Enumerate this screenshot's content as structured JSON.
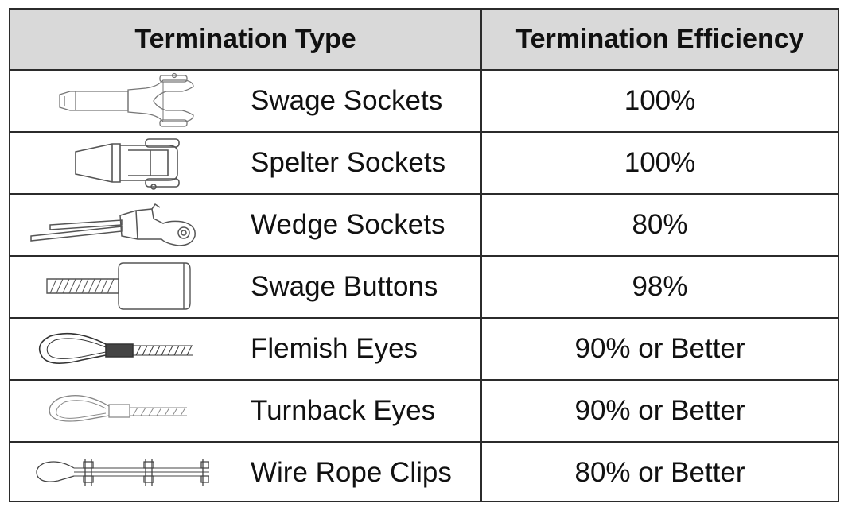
{
  "header": {
    "col1": "Termination Type",
    "col2": "Termination Efficiency"
  },
  "rows": [
    {
      "type": "Swage Sockets",
      "efficiency": "100%",
      "icon": "swage-socket-icon"
    },
    {
      "type": "Spelter Sockets",
      "efficiency": "100%",
      "icon": "spelter-socket-icon"
    },
    {
      "type": "Wedge Sockets",
      "efficiency": "80%",
      "icon": "wedge-socket-icon"
    },
    {
      "type": "Swage Buttons",
      "efficiency": "98%",
      "icon": "swage-button-icon"
    },
    {
      "type": "Flemish Eyes",
      "efficiency": "90% or Better",
      "icon": "flemish-eye-icon"
    },
    {
      "type": "Turnback Eyes",
      "efficiency": "90% or Better",
      "icon": "turnback-eye-icon"
    },
    {
      "type": "Wire Rope Clips",
      "efficiency": "80% or Better",
      "icon": "wire-rope-clips-icon"
    }
  ]
}
